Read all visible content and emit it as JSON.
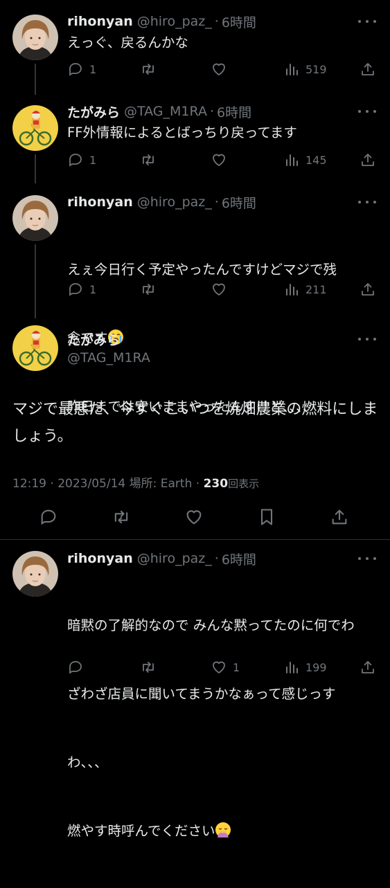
{
  "tweets": [
    {
      "name": "rihonyan",
      "handle": "@hiro_paz_",
      "dot": "·",
      "time": "6時間",
      "text": "えっぐ、戻るんかな",
      "replies": "1",
      "views": "519"
    },
    {
      "name": "たがみら",
      "handle": "@TAG_M1RA",
      "dot": "·",
      "time": "6時間",
      "text": "FF外情報によるとばっちり戻ってます",
      "replies": "1",
      "views": "145"
    },
    {
      "name": "rihonyan",
      "handle": "@hiro_paz_",
      "dot": "·",
      "time": "6時間",
      "text_line1": "えぇ今日行く予定やったんですけどマジで残",
      "text_line2": "念です",
      "text_line3": "昨日までは安いままやったんすけど、、、、",
      "emoji": "loudly-crying-face",
      "replies": "1",
      "views": "211"
    }
  ],
  "main_tweet": {
    "name": "たがみら",
    "handle": "@TAG_M1RA",
    "text": "マジで最悪だ、今すぐこいつを焼畑農業の燃料にしましょう。",
    "time": "12:19",
    "sep1": "·",
    "date": "2023/05/14",
    "location_label": "場所:",
    "location": "Earth",
    "sep2": "·",
    "views_count": "230",
    "views_label": "回表示"
  },
  "reply": {
    "name": "rihonyan",
    "handle": "@hiro_paz_",
    "dot": "·",
    "time": "6時間",
    "text_line1": "暗黙の了解的なので みんな黙ってたのに何でわ",
    "text_line2": "ざわざ店員に聞いてまうかなぁって感じっす",
    "text_line3": "わ、、、",
    "text_line4": "燃やす時呼んでください",
    "emoji": "face-with-hand-over-mouth",
    "likes": "1",
    "views": "199"
  },
  "colors": {
    "background": "#000000",
    "text": "#e7e9ea",
    "secondary": "#71767b",
    "divider": "#2f3336",
    "avatar_yellow": "#f2d048"
  }
}
